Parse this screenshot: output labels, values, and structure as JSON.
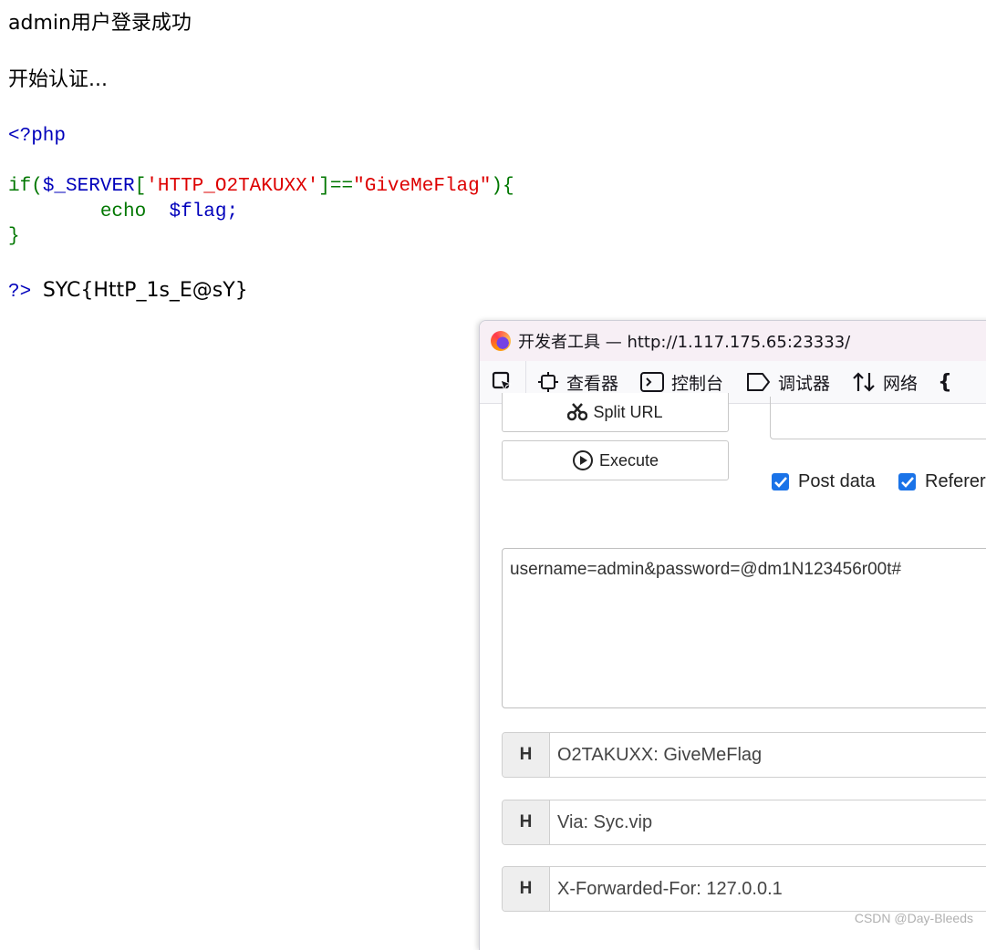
{
  "page": {
    "login_message": "admin用户登录成功",
    "auth_message": "开始认证...",
    "code": {
      "open_tag": "<?php",
      "if_kw": "if",
      "if_open": "(",
      "server_var": "$_SERVER",
      "bracket_open": "[",
      "header_key": "'HTTP_O2TAKUXX'",
      "bracket_close_eq": "]==",
      "header_value": "\"GiveMeFlag\"",
      "if_close": "){",
      "echo_kw": "echo",
      "flag_var": "$flag;",
      "close_brace": "}",
      "close_tag": "?>",
      "flag_output": "SYC{HttP_1s_E@sY}"
    }
  },
  "devtools": {
    "title": "开发者工具 — http://1.117.175.65:23333/",
    "tabs": [
      {
        "label": "查看器",
        "icon": "inspector-icon"
      },
      {
        "label": "控制台",
        "icon": "console-icon"
      },
      {
        "label": "调试器",
        "icon": "debugger-icon"
      },
      {
        "label": "网络",
        "icon": "network-icon"
      }
    ],
    "tab_overflow": "{",
    "hackbar": {
      "split_url_label": "Split URL",
      "execute_label": "Execute",
      "post_data_label": "Post data",
      "referer_label": "Referer",
      "post_body": "username=admin&password=@dm1N123456r00t#",
      "header_badge": "H",
      "headers": [
        "O2TAKUXX: GiveMeFlag",
        "Via: Syc.vip",
        "X-Forwarded-For: 127.0.0.1"
      ]
    }
  },
  "watermark": "CSDN @Day-Bleeds"
}
